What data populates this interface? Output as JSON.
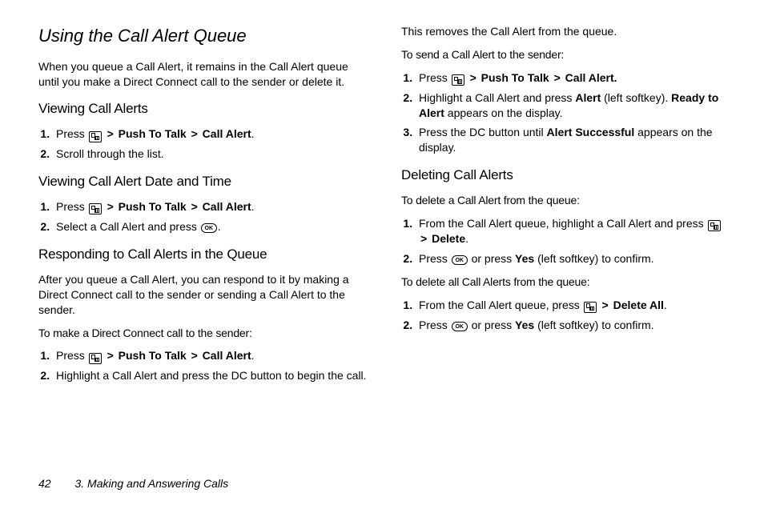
{
  "title": "Using the Call Alert Queue",
  "left": {
    "intro": "When you queue a Call Alert, it remains in the Call Alert queue until you make a Direct Connect call to the sender or delete it.",
    "h_view": "Viewing Call Alerts",
    "view_steps": {
      "s1_pre": "Press",
      "s1_ptt": "Push To Talk",
      "s1_ca": "Call Alert",
      "s2": "Scroll through the list."
    },
    "h_datetime": "Viewing Call Alert Date and Time",
    "dt_steps": {
      "s1_pre": "Press",
      "s1_ptt": "Push To Talk",
      "s1_ca": "Call Alert",
      "s2_pre": "Select a Call Alert and press",
      "s2_post": "."
    },
    "h_respond": "Responding to Call Alerts in the Queue",
    "respond_intro": "After you queue a Call Alert, you can respond to it by making a Direct Connect call to the sender or sending a Call Alert to the sender.",
    "sub_dc": "To make a Direct Connect call to the sender:",
    "dc_steps": {
      "s1_pre": "Press",
      "s1_ptt": "Push To Talk",
      "s1_ca": "Call Alert",
      "s2": "Highlight a Call Alert and press the DC button to begin the call."
    }
  },
  "right": {
    "remove": "This removes the Call Alert from the queue.",
    "sub_send": "To send a Call Alert to the sender:",
    "send_steps": {
      "s1_pre": "Press",
      "s1_ptt": "Push To Talk",
      "s1_ca": "Call Alert.",
      "s2_pre": "Highlight a Call Alert and press",
      "s2_alert": "Alert",
      "s2_mid": "(left softkey).",
      "s2_ready": "Ready to Alert",
      "s2_post": "appears on the display.",
      "s3_pre": "Press the DC button until",
      "s3_bold": "Alert Successful",
      "s3_post": "appears on the display."
    },
    "h_delete": "Deleting Call Alerts",
    "sub_del_one": "To delete a Call Alert from the queue:",
    "del_one_steps": {
      "s1_pre": "From the Call Alert queue, highlight a Call Alert and press",
      "s1_del": "Delete",
      "s2_pre": "Press",
      "s2_mid": "or press",
      "s2_yes": "Yes",
      "s2_post": "(left softkey) to confirm."
    },
    "sub_del_all": "To delete all Call Alerts from the queue:",
    "del_all_steps": {
      "s1_pre": "From the Call Alert queue, press",
      "s1_del": "Delete All",
      "s2_pre": "Press",
      "s2_mid": "or press",
      "s2_yes": "Yes",
      "s2_post": "(left softkey) to confirm."
    }
  },
  "footer": {
    "page": "42",
    "chapter": "3. Making and Answering Calls"
  },
  "glyphs": {
    "gt": ">",
    "ok": "OK",
    "period": "."
  }
}
